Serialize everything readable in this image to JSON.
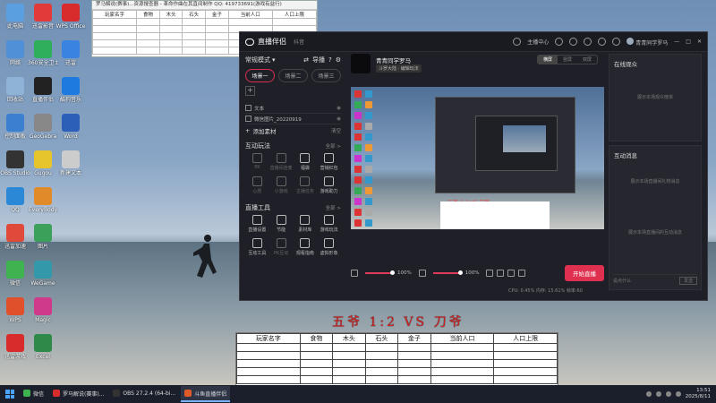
{
  "desktop_icons": [
    {
      "label": "此电脑",
      "color": "#5aa0e0",
      "col": 0,
      "row": 0
    },
    {
      "label": "迅雷影音",
      "color": "#e23a3a",
      "col": 1,
      "row": 0
    },
    {
      "label": "WPS Office",
      "color": "#d82b2b",
      "col": 2,
      "row": 0
    },
    {
      "label": "网络",
      "color": "#4f90d6",
      "col": 0,
      "row": 1
    },
    {
      "label": "360安全卫士",
      "color": "#2fae5c",
      "col": 1,
      "row": 1
    },
    {
      "label": "迅雷",
      "color": "#3b83e0",
      "col": 2,
      "row": 1
    },
    {
      "label": "回收站",
      "color": "#8fb3d6",
      "col": 0,
      "row": 2
    },
    {
      "label": "直播伴侣",
      "color": "#222",
      "col": 1,
      "row": 2
    },
    {
      "label": "酷狗音乐",
      "color": "#1f7ae0",
      "col": 2,
      "row": 2
    },
    {
      "label": "控制面板",
      "color": "#3a7fd0",
      "col": 0,
      "row": 3
    },
    {
      "label": "GeoGebra",
      "color": "#888",
      "col": 1,
      "row": 3
    },
    {
      "label": "Word",
      "color": "#2b5fb8",
      "col": 2,
      "row": 3
    },
    {
      "label": "OBS Studio",
      "color": "#333",
      "col": 0,
      "row": 4
    },
    {
      "label": "Gugou",
      "color": "#e6c52c",
      "col": 1,
      "row": 4
    },
    {
      "label": "新建文本",
      "color": "#ccc",
      "col": 2,
      "row": 4
    },
    {
      "label": "QQ",
      "color": "#2a88d6",
      "col": 0,
      "row": 5
    },
    {
      "label": "EveryBody",
      "color": "#e08a2a",
      "col": 1,
      "row": 5
    },
    {
      "label": "迅雷加速",
      "color": "#e04a3a",
      "col": 0,
      "row": 6
    },
    {
      "label": "图片",
      "color": "#3aa05a",
      "col": 1,
      "row": 6
    },
    {
      "label": "微信",
      "color": "#3fb34f",
      "col": 0,
      "row": 7
    },
    {
      "label": "WeGame",
      "color": "#39a",
      "col": 1,
      "row": 7
    },
    {
      "label": "WPS",
      "color": "#e0502a",
      "col": 0,
      "row": 8
    },
    {
      "label": "Magic",
      "color": "#d03a8a",
      "col": 1,
      "row": 8
    },
    {
      "label": "迅雷游戏",
      "color": "#d82b2b",
      "col": 0,
      "row": 9
    },
    {
      "label": "Excel",
      "color": "#2f8a4a",
      "col": 1,
      "row": 9
    }
  ],
  "excel_top": {
    "title": "罗马解说(赛事)...资源搜查器 - 革命作曲在其直间制作 QQ: 419733691(游戏有益行)",
    "headers": [
      "玩家名字",
      "食物",
      "木头",
      "石头",
      "金子",
      "当前人口",
      "人口上限"
    ]
  },
  "app": {
    "title": "直播伴侣",
    "subtitle": "抖音",
    "topbar": {
      "host_center": "主播中心",
      "user": "青青同学罗马"
    },
    "mode": "常规模式",
    "import_label": "导播",
    "scenes": [
      "场景一",
      "场景二",
      "场景三"
    ],
    "sources": [
      {
        "label": "文本"
      },
      {
        "label": "微信图片_20220919"
      }
    ],
    "add_material": "添加素材",
    "clear": "清空",
    "interactive": {
      "title": "互动玩法",
      "all": "全部 >",
      "items": [
        {
          "label": "PK",
          "dim": true
        },
        {
          "label": "直播间连麦",
          "dim": true
        },
        {
          "label": "福袋",
          "dim": false
        },
        {
          "label": "营销红包",
          "dim": false
        },
        {
          "label": "心愿",
          "dim": true
        },
        {
          "label": "小游戏",
          "dim": true
        },
        {
          "label": "主播任务",
          "dim": true
        },
        {
          "label": "游戏助力",
          "dim": false
        }
      ]
    },
    "tools": {
      "title": "直播工具",
      "all": "全部 >",
      "items": [
        {
          "label": "直播设置",
          "dim": false
        },
        {
          "label": "节能",
          "dim": false
        },
        {
          "label": "素材库",
          "dim": false
        },
        {
          "label": "游戏玩法",
          "dim": false
        },
        {
          "label": "互动工具",
          "dim": false
        },
        {
          "label": "PK互动",
          "dim": true
        },
        {
          "label": "观看指南",
          "dim": false
        },
        {
          "label": "虚拟形象",
          "dim": false
        }
      ]
    },
    "preview": {
      "name": "青青同学罗马",
      "tag": "斗罗大陆 · 编辑玩法",
      "orient": [
        "横屏",
        "竖屏",
        "双屏"
      ],
      "canvas_title": "五爷 1:2 VS 刀爷"
    },
    "controls": {
      "mic_volume": "100%",
      "mic_fill": 0.95,
      "spk_volume": "100%",
      "spk_fill": 0.95,
      "start": "开始直播"
    },
    "stats": "CPU: 0.45%  内存: 15.61%  帧率:60",
    "right": {
      "viewers_title": "在线观众",
      "viewers_empty": "展示本场观众榜单",
      "messages_title": "互动消息",
      "messages_empty": "展示本场直播间礼物消息",
      "chat_empty": "展示本场直播间的互动消息",
      "chat_placeholder": "说点什么",
      "send": "发送"
    }
  },
  "overlay_title": "五爷 1:2 VS 刀爷",
  "excel_bottom": {
    "headers": [
      "玩家名字",
      "食物",
      "木头",
      "石头",
      "金子",
      "当前人口",
      "人口上限"
    ]
  },
  "taskbar": {
    "tasks": [
      {
        "label": "微信",
        "color": "#3fb34f",
        "active": false
      },
      {
        "label": "罗马解说(赛事)...",
        "color": "#d82b2b",
        "active": false
      },
      {
        "label": "OBS 27.2.4 (64-bi...",
        "color": "#333",
        "active": false
      },
      {
        "label": "斗鱼直播伴侣",
        "color": "#e05a2a",
        "active": true
      }
    ],
    "time": "13:51",
    "date": "2025/8/11"
  }
}
